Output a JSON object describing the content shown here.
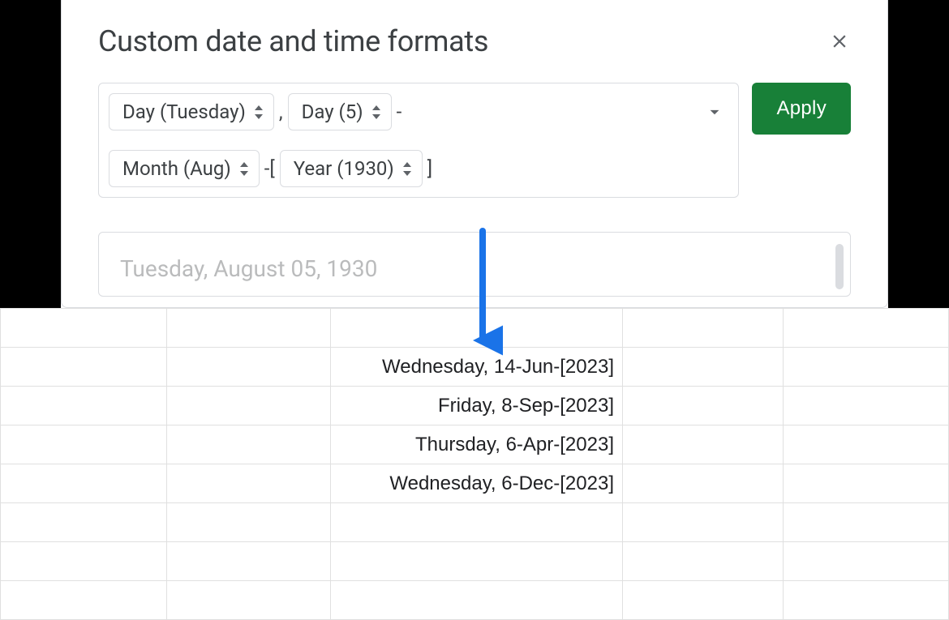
{
  "dialog": {
    "title": "Custom date and time formats",
    "apply_label": "Apply",
    "chips": {
      "day_name": "Day (Tuesday)",
      "day_num": "Day (5)",
      "month": "Month (Aug)",
      "year": "Year (1930)"
    },
    "separators": {
      "comma": ",",
      "dash": "-",
      "dash_bracket_open": "-[",
      "bracket_close": "]"
    },
    "preview": "Tuesday, August 05, 1930"
  },
  "sheet": {
    "rows": [
      [
        "",
        "",
        "",
        "",
        ""
      ],
      [
        "",
        "",
        "Wednesday, 14-Jun-[2023]",
        "",
        ""
      ],
      [
        "",
        "",
        "Friday, 8-Sep-[2023]",
        "",
        ""
      ],
      [
        "",
        "",
        "Thursday, 6-Apr-[2023]",
        "",
        ""
      ],
      [
        "",
        "",
        "Wednesday, 6-Dec-[2023]",
        "",
        ""
      ],
      [
        "",
        "",
        "",
        "",
        ""
      ],
      [
        "",
        "",
        "",
        "",
        ""
      ],
      [
        "",
        "",
        "",
        "",
        ""
      ]
    ]
  }
}
